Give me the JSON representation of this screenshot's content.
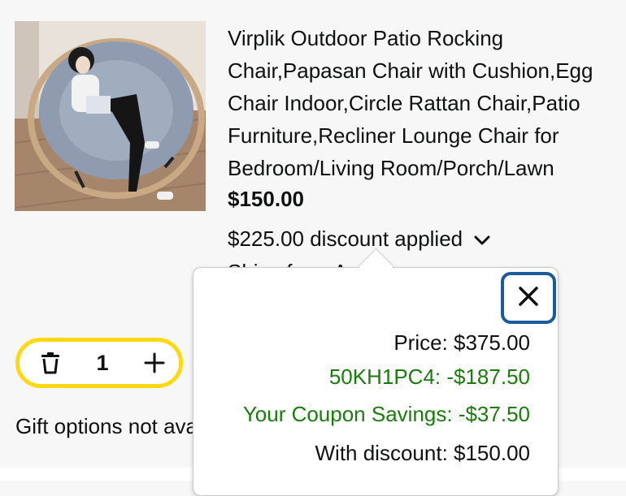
{
  "product": {
    "title": "Virplik Outdoor Patio Rocking Chair,Papasan Chair with Cushion,Egg Chair Indoor,Circle Rattan Chair,Patio Furniture,Recliner Lounge Chair for Bedroom/Living Room/Porch/Lawn",
    "price": "$150.00",
    "discount_text": "$225.00 discount applied",
    "ships_from": "Ships from Amazon.com",
    "image_icon": "product-photo-papasan-chair"
  },
  "cart": {
    "quantity": "1",
    "gift_options": "Gift options not available",
    "delete_icon": "trash-icon",
    "add_icon": "plus-icon"
  },
  "popover": {
    "close_icon": "close-icon",
    "lines": [
      {
        "label": "Price: $375.00",
        "color": "#0f1111"
      },
      {
        "label": "50KH1PC4: -$187.50",
        "color": "#1b7c0e"
      },
      {
        "label": "Your Coupon Savings: -$37.50",
        "color": "#1b7c0e"
      },
      {
        "label": "With discount: $150.00",
        "color": "#0f1111"
      }
    ]
  },
  "colors": {
    "accent_yellow": "#ffd814",
    "focus_blue": "#1c5a9b",
    "savings_green": "#1b7c0e"
  }
}
